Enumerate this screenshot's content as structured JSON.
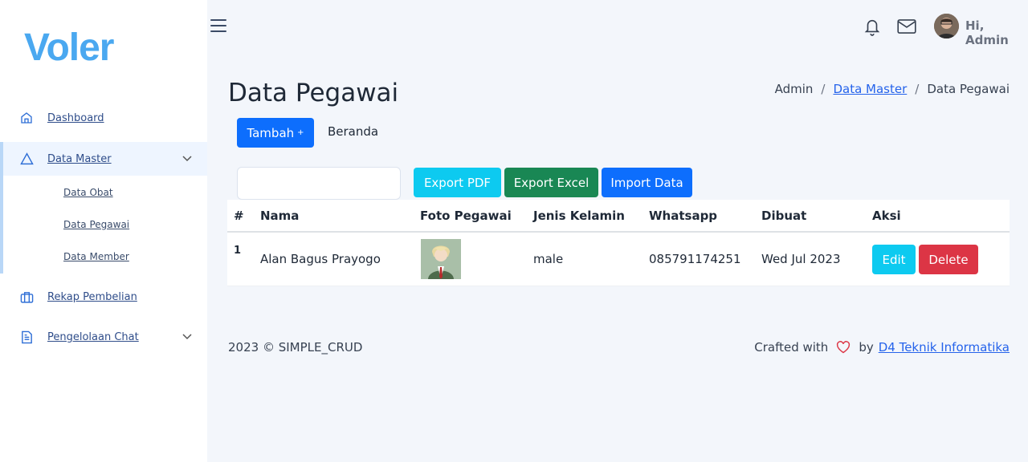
{
  "sidebar": {
    "logo": "Voler",
    "items": [
      {
        "label": "Dashboard",
        "icon": "home-icon"
      },
      {
        "label": "Data Master",
        "icon": "triangle-icon"
      },
      {
        "label": "Rekap Pembelian",
        "icon": "briefcase-icon"
      },
      {
        "label": "Pengelolaan Chat",
        "icon": "file-text-icon"
      }
    ],
    "submenu": [
      "Data Obat",
      "Data Pegawai",
      "Data Member"
    ]
  },
  "header": {
    "greeting": "Hi, Admin"
  },
  "page": {
    "title": "Data Pegawai",
    "breadcrumb": [
      "Admin",
      "Data Master",
      "Data Pegawai"
    ],
    "add_button": "Tambah",
    "add_plus": "+",
    "home_link": "Beranda",
    "export_pdf": "Export PDF",
    "export_excel": "Export Excel",
    "import_data": "Import Data"
  },
  "table": {
    "headers": [
      "#",
      "Nama",
      "Foto Pegawai",
      "Jenis Kelamin",
      "Whatsapp",
      "Dibuat",
      "Aksi"
    ],
    "rows": [
      {
        "no": "1",
        "nama": "Alan Bagus Prayogo",
        "jenis_kelamin": "male",
        "whatsapp": "085791174251",
        "dibuat": "Wed Jul 2023",
        "edit": "Edit",
        "delete": "Delete"
      }
    ]
  },
  "footer": {
    "left": "2023 © SIMPLE_CRUD",
    "crafted": "Crafted with",
    "by": "by",
    "author": "D4 Teknik Informatika"
  },
  "colors": {
    "primary": "#0d6efd",
    "info": "#0dcaf0",
    "success": "#198754",
    "danger": "#dc3545",
    "logo": "#4aa8f0"
  }
}
